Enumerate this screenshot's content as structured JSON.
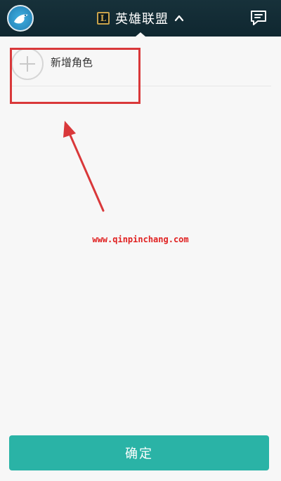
{
  "header": {
    "game_logo_letter": "L",
    "title": "英雄联盟",
    "avatar_icon": "bird-avatar-icon",
    "message_icon": "chat-bubble-icon"
  },
  "character_list": {
    "add_label": "新增角色"
  },
  "watermark": "www.qinpinchang.com",
  "footer": {
    "confirm_label": "确定"
  },
  "colors": {
    "header_bg": "#0f2730",
    "accent": "#2ab3a6",
    "annotation": "#d9383a"
  }
}
